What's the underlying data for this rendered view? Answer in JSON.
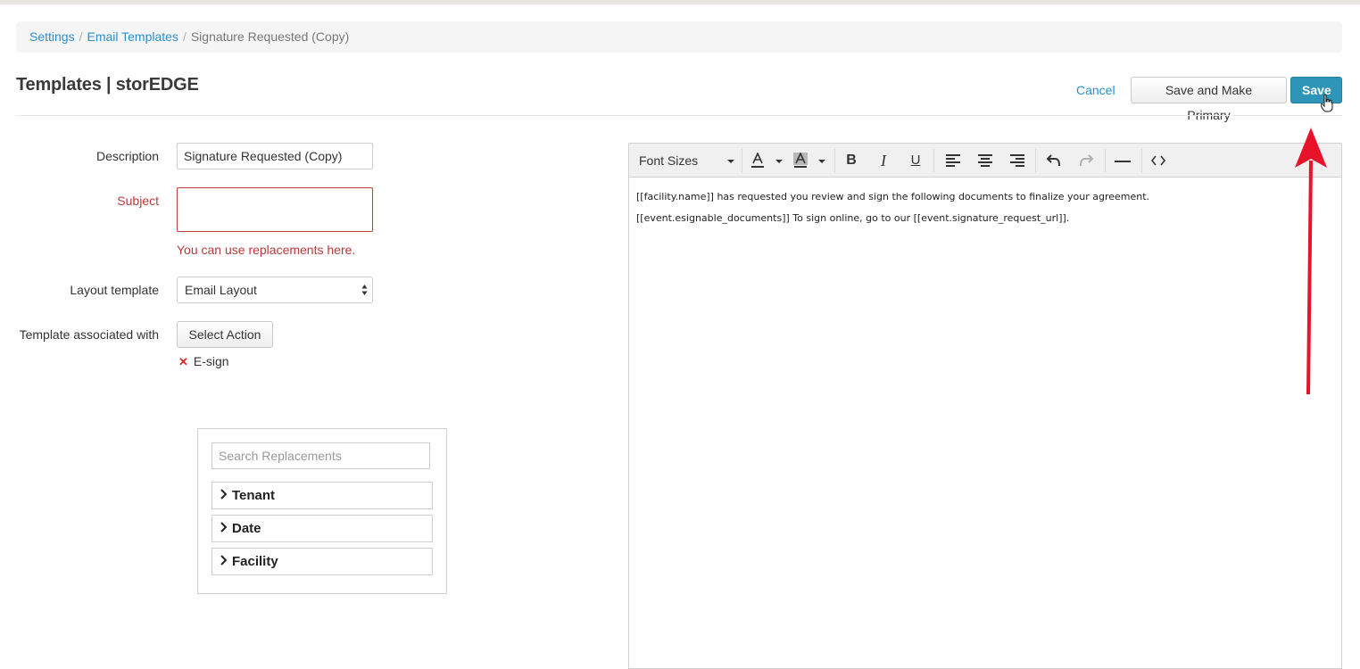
{
  "breadcrumb": {
    "items": [
      "Settings",
      "Email Templates"
    ],
    "current": "Signature Requested (Copy)",
    "separator": "/"
  },
  "header": {
    "title": "Templates | storEDGE",
    "cancel_label": "Cancel",
    "save_primary_label": "Save and Make Primary",
    "save_label": "Save"
  },
  "form": {
    "description_label": "Description",
    "description_value": "Signature Requested (Copy)",
    "subject_label": "Subject",
    "subject_value": "",
    "subject_help": "You can use replacements here.",
    "layout_label": "Layout template",
    "layout_value": "Email Layout",
    "associated_label": "Template associated with",
    "select_action_label": "Select Action",
    "associated_tags": [
      "E-sign"
    ]
  },
  "replacements": {
    "search_placeholder": "Search Replacements",
    "groups": [
      "Tenant",
      "Date",
      "Facility"
    ]
  },
  "editor": {
    "font_sizes_label": "Font Sizes",
    "toolbar_icons": [
      "font-color-icon",
      "background-color-icon",
      "bold-icon",
      "italic-icon",
      "underline-icon",
      "align-left-icon",
      "align-center-icon",
      "align-right-icon",
      "undo-icon",
      "redo-icon",
      "horizontal-rule-icon",
      "code-view-icon"
    ],
    "lines": [
      "[[facility.name]] has requested you review and sign the following documents to finalize your agreement.",
      "[[event.esignable_documents]] To sign online, go to our [[event.signature_request_url]]."
    ]
  },
  "colors": {
    "link": "#2a8fce",
    "primary_button": "#2e94b8",
    "error": "#b93939",
    "annotation_arrow": "#e8132a"
  }
}
